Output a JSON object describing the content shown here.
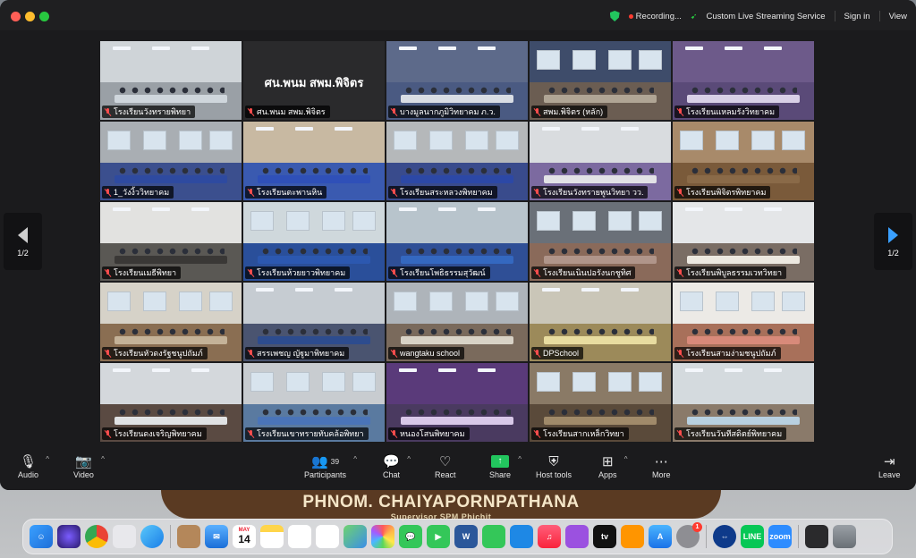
{
  "topbar": {
    "recording": "Recording...",
    "streaming": "Custom Live Streaming Service",
    "sign_in": "Sign in",
    "view": "View"
  },
  "pagination": {
    "left": "1/2",
    "right": "1/2"
  },
  "tiles": [
    {
      "label": "โรงเรียนวังทรายพิทยา",
      "wall": "#cfd4d8",
      "floor": "#9aa0a6",
      "table": "#cfd6dc"
    },
    {
      "label": "ศน.พนม สพม.พิจิตร",
      "text": "ศน.พนม สพม.พิจิตร"
    },
    {
      "label": "บางมูลนากภูมิวิทยาคม ภ.ว.",
      "wall": "#5d6a8a",
      "floor": "#4a5a82",
      "table": "#d9dde4"
    },
    {
      "label": "สพม.พิจิตร (หลัก)",
      "wall": "#3e4c6a",
      "floor": "#6b5d52",
      "table": "#b0a595",
      "active": true
    },
    {
      "label": "โรงเรียนแหลมรังวิทยาคม",
      "wall": "#6d5a8a",
      "floor": "#5a4a78",
      "table": "#d8d0e6"
    },
    {
      "label": "1_วังงิ้ววิทยาคม",
      "wall": "#a9aeb3",
      "floor": "#3b4f8e",
      "table": "#2e4aa0"
    },
    {
      "label": "โรงเรียนตะพานหิน",
      "wall": "#c8b9a2",
      "floor": "#3a5ab0",
      "table": "#2f50b8"
    },
    {
      "label": "โรงเรียนสระหลวงพิทยาคม",
      "wall": "#b5b8ba",
      "floor": "#394b8c",
      "table": "#2c48a6"
    },
    {
      "label": "โรงเรียนวังทรายพูนวิทยา วว.",
      "wall": "#d9dcdf",
      "floor": "#7c6aa0",
      "table": "#e2e2e6"
    },
    {
      "label": "โรงเรียนพิจิตรพิทยาคม",
      "wall": "#a88a6a",
      "floor": "#7a5a3a",
      "table": "#8a6a48"
    },
    {
      "label": "โรงเรียนเมธีพิทยา",
      "wall": "#e2e2e0",
      "floor": "#5a5854",
      "table": "#3a3836"
    },
    {
      "label": "โรงเรียนห้วยยาวพิทยาคม",
      "wall": "#cfd8dc",
      "floor": "#2a4f9a",
      "table": "#2c58b0"
    },
    {
      "label": "โรงเรียนโพธิธรรมสุวัฒน์",
      "wall": "#b8c4cc",
      "floor": "#2f4f96",
      "table": "#3468c0"
    },
    {
      "label": "โรงเรียนเนินปอรังนกชูทิศ",
      "wall": "#6a7078",
      "floor": "#8a6a5a",
      "table": "#b0958a"
    },
    {
      "label": "โรงเรียนพิบูลธรรมเวทวิทยา",
      "wall": "#e4e6e8",
      "floor": "#7a6d64",
      "table": "#ece8e0"
    },
    {
      "label": "โรงเรียนหัวดงรัฐชนูปถัมภ์",
      "wall": "#d6d2c8",
      "floor": "#8a6e52",
      "table": "#c4b298"
    },
    {
      "label": "สรรเพชญ ญัฐูมาพิทยาคม",
      "wall": "#c6ccd2",
      "floor": "#4a5470",
      "table": "#2d4c8e"
    },
    {
      "label": "wangtaku school",
      "wall": "#aeb4ba",
      "floor": "#7a6a5c",
      "table": "#d8d2c6"
    },
    {
      "label": "DPSchool",
      "wall": "#cac6b8",
      "floor": "#9c8a5a",
      "table": "#e8dca0"
    },
    {
      "label": "โรงเรียนสามง่ามชนูปถัมภ์",
      "wall": "#eceae6",
      "floor": "#a8705a",
      "table": "#d88a7a"
    },
    {
      "label": "โรงเรียนดงเจริญพิทยาคม",
      "wall": "#d4d8dc",
      "floor": "#5a4a42",
      "table": "#e0e2e4"
    },
    {
      "label": "โรงเรียนเขาทรายทับคล้อพิทยา",
      "wall": "#c8ccd0",
      "floor": "#5a7aa0",
      "table": "#4a74b8"
    },
    {
      "label": "หนองโสนพิทยาคม",
      "wall": "#5a3a7a",
      "floor": "#4a3a60",
      "table": "#d8c8e8"
    },
    {
      "label": "โรงเรียนสากเหล็กวิทยา",
      "wall": "#8a7a66",
      "floor": "#5a4a3a",
      "table": "#a08a6a"
    },
    {
      "label": "โรงเรียนวันทีสดิตย์พิทยาคม",
      "wall": "#d4dade",
      "floor": "#8a7a6a",
      "table": "#b8d0e0"
    }
  ],
  "toolbar": {
    "audio": "Audio",
    "video": "Video",
    "participants": "Participants",
    "participants_count": "39",
    "chat": "Chat",
    "react": "React",
    "share": "Share",
    "host_tools": "Host tools",
    "apps": "Apps",
    "more": "More",
    "leave": "Leave"
  },
  "banner": {
    "title": "PHNOM. CHAIYAPORNPATHANA",
    "subtitle": "Supervisor SPM Phichit"
  },
  "dock": {
    "calendar_month": "MAY",
    "calendar_day": "14",
    "settings_badge": "1",
    "tv_label": "tv",
    "zoom_label": "zoom",
    "line_label": "LINE",
    "word_label": "W"
  },
  "colors": {
    "accent_green": "#22c55e",
    "active_outline": "#2fd157",
    "nav_arrow_blue": "#3aa0ff"
  }
}
